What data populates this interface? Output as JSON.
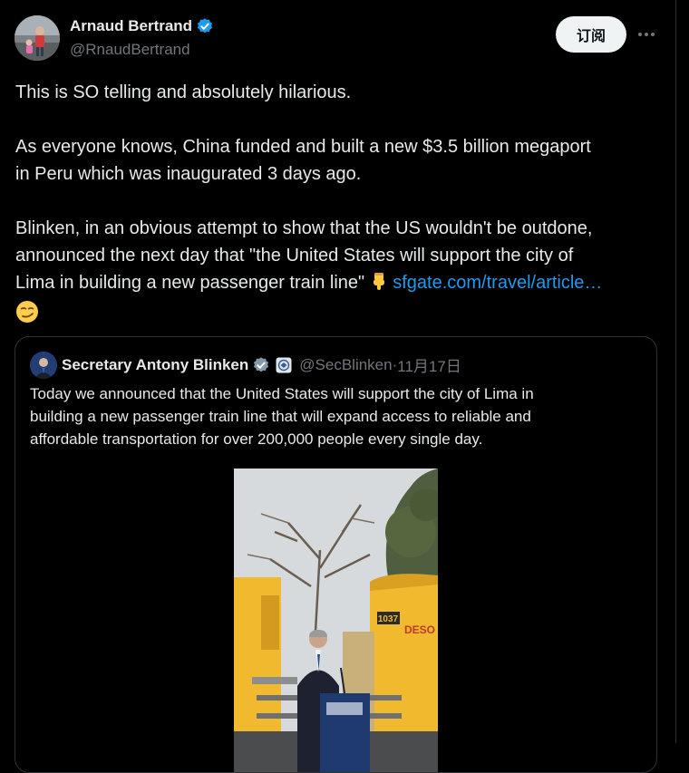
{
  "author": {
    "name": "Arnaud Bertrand",
    "handle": "@RnaudBertrand"
  },
  "actions": {
    "subscribe_label": "订阅"
  },
  "tweet": {
    "line1": "This is SO telling and absolutely hilarious.",
    "line2": "As everyone knows, China funded and built a new $3.5 billion megaport",
    "line3": "in Peru which was inaugurated 3 days ago.",
    "line4": "Blinken, in an obvious attempt to show that the US wouldn't be outdone,",
    "line5": "announced the next day that \"the United States will support the city of",
    "line6": "Lima in building a new passenger train line\"",
    "link_text": "sfgate.com/travel/article…"
  },
  "quote": {
    "name": "Secretary Antony Blinken",
    "handle": "@SecBlinken",
    "separator": " · ",
    "date": "11月17日",
    "line1": "Today we announced that the United States will support the city of Lima in",
    "line2": "building a new passenger train line that will expand access to reliable and",
    "line3": "affordable transportation for over 200,000 people every single day."
  },
  "media": {
    "train_number": "1037",
    "train_lettering": "DESO"
  },
  "colors": {
    "background": "#000000",
    "text": "#e7e9ea",
    "muted": "#71767b",
    "link": "#1d9bf0",
    "verified_badge": "#1d9bf0",
    "train_yellow": "#f0b92e"
  },
  "icons": [
    "verified-badge-icon",
    "more-options-icon",
    "pointing-down-emoji",
    "smirk-emoji",
    "government-badge-icon"
  ]
}
